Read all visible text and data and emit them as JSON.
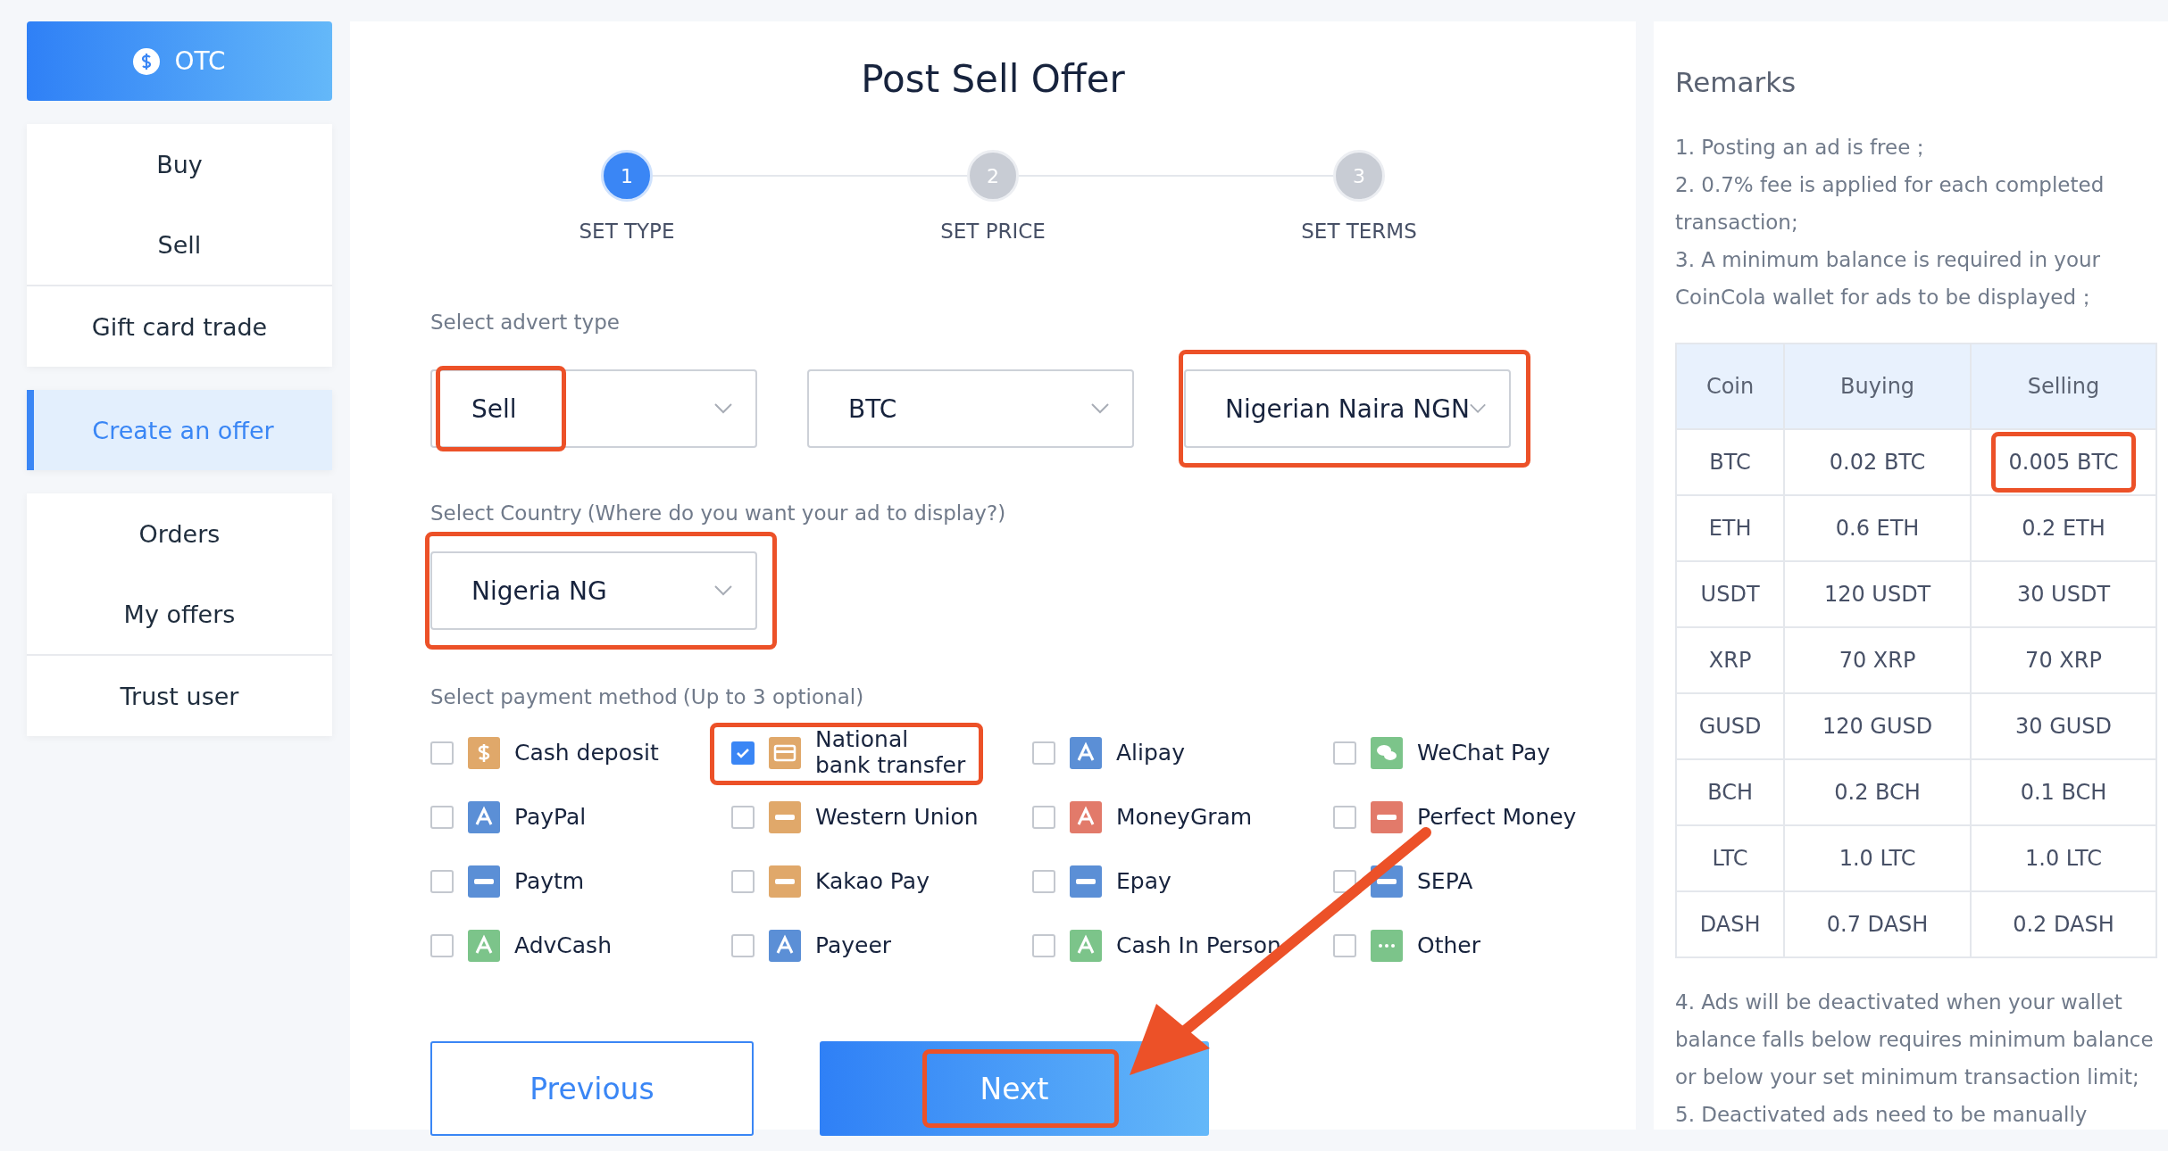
{
  "sidebar": {
    "header": {
      "label": "OTC"
    },
    "groups": [
      [
        {
          "label": "Buy",
          "selected": false
        },
        {
          "label": "Sell",
          "selected": false
        },
        {
          "label": "Gift card trade",
          "selected": false,
          "divided": true
        }
      ],
      [
        {
          "label": "Create an offer",
          "selected": true
        }
      ],
      [
        {
          "label": "Orders",
          "selected": false
        },
        {
          "label": "My offers",
          "selected": false
        },
        {
          "label": "Trust user",
          "selected": false,
          "divided": true
        }
      ]
    ]
  },
  "form": {
    "title": "Post Sell Offer",
    "steps": [
      {
        "number": "1",
        "label": "SET TYPE",
        "selected": true
      },
      {
        "number": "2",
        "label": "SET PRICE",
        "selected": false
      },
      {
        "number": "3",
        "label": "SET TERMS",
        "selected": false
      }
    ],
    "advert_type": {
      "label": "Select advert type",
      "selects": [
        {
          "value": "Sell",
          "highlighted": true
        },
        {
          "value": "BTC",
          "highlighted": false
        },
        {
          "value": "Nigerian Naira NGN",
          "highlighted": true
        }
      ]
    },
    "country": {
      "label": "Select Country",
      "hint": "(Where do you want your ad to display?)",
      "select": {
        "value": "Nigeria NG",
        "highlighted": true
      }
    },
    "payment": {
      "label": "Select payment method",
      "hint": "(Up to 3 optional)",
      "methods": [
        {
          "label": "Cash deposit",
          "checked": false,
          "highlighted": false,
          "kind": "dollar",
          "color": "#e0a86a"
        },
        {
          "label": "National bank transfer",
          "checked": true,
          "highlighted": true,
          "kind": "card",
          "color": "#e0a86a"
        },
        {
          "label": "Alipay",
          "checked": false,
          "highlighted": false,
          "kind": "glyph",
          "color": "#5b8fd6"
        },
        {
          "label": "WeChat Pay",
          "checked": false,
          "highlighted": false,
          "kind": "chat",
          "color": "#7cc48a"
        },
        {
          "label": "PayPal",
          "checked": false,
          "highlighted": false,
          "kind": "glyph",
          "color": "#5b8fd6"
        },
        {
          "label": "Western Union",
          "checked": false,
          "highlighted": false,
          "kind": "bars",
          "color": "#e0a86a"
        },
        {
          "label": "MoneyGram",
          "checked": false,
          "highlighted": false,
          "kind": "glyph",
          "color": "#e27a6a"
        },
        {
          "label": "Perfect Money",
          "checked": false,
          "highlighted": false,
          "kind": "bars",
          "color": "#e27a6a"
        },
        {
          "label": "Paytm",
          "checked": false,
          "highlighted": false,
          "kind": "bars",
          "color": "#5b8fd6"
        },
        {
          "label": "Kakao Pay",
          "checked": false,
          "highlighted": false,
          "kind": "bars",
          "color": "#e0a86a"
        },
        {
          "label": "Epay",
          "checked": false,
          "highlighted": false,
          "kind": "bars",
          "color": "#5b8fd6"
        },
        {
          "label": "SEPA",
          "checked": false,
          "highlighted": false,
          "kind": "bars",
          "color": "#5b8fd6"
        },
        {
          "label": "AdvCash",
          "checked": false,
          "highlighted": false,
          "kind": "glyph",
          "color": "#7cc48a"
        },
        {
          "label": "Payeer",
          "checked": false,
          "highlighted": false,
          "kind": "glyph",
          "color": "#5b8fd6"
        },
        {
          "label": "Cash In Person",
          "checked": false,
          "highlighted": false,
          "kind": "glyph",
          "color": "#7cc48a"
        },
        {
          "label": "Other",
          "checked": false,
          "highlighted": false,
          "kind": "dots",
          "color": "#7cc48a"
        }
      ]
    },
    "buttons": [
      {
        "label": "Previous",
        "kind": "outline",
        "highlighted": false
      },
      {
        "label": "Next",
        "kind": "primary",
        "highlighted": true
      }
    ]
  },
  "remarks": {
    "title": "Remarks",
    "notes_before": [
      "1. Posting an ad is free；",
      "2. 0.7% fee is applied for each completed transaction;",
      "3. A minimum balance is required in your CoinCola wallet for ads to be displayed；"
    ],
    "table": {
      "columns": [
        "Coin",
        "Buying",
        "Selling"
      ],
      "rows": [
        [
          {
            "text": "BTC"
          },
          {
            "text": "0.02 BTC"
          },
          {
            "text": "0.005 BTC",
            "highlighted": true
          }
        ],
        [
          {
            "text": "ETH"
          },
          {
            "text": "0.6 ETH"
          },
          {
            "text": "0.2 ETH"
          }
        ],
        [
          {
            "text": "USDT"
          },
          {
            "text": "120 USDT"
          },
          {
            "text": "30 USDT"
          }
        ],
        [
          {
            "text": "XRP"
          },
          {
            "text": "70 XRP"
          },
          {
            "text": "70 XRP"
          }
        ],
        [
          {
            "text": "GUSD"
          },
          {
            "text": "120 GUSD"
          },
          {
            "text": "30 GUSD"
          }
        ],
        [
          {
            "text": "BCH"
          },
          {
            "text": "0.2 BCH"
          },
          {
            "text": "0.1 BCH"
          }
        ],
        [
          {
            "text": "LTC"
          },
          {
            "text": "1.0 LTC"
          },
          {
            "text": "1.0 LTC"
          }
        ],
        [
          {
            "text": "DASH"
          },
          {
            "text": "0.7 DASH"
          },
          {
            "text": "0.2 DASH"
          }
        ]
      ]
    },
    "notes_after": [
      "4. Ads will be deactivated when your wallet balance falls below requires minimum balance or below your set minimum transaction limit;",
      "5. Deactivated ads need to be manually"
    ]
  },
  "annotation_arrow": {
    "shown": true
  }
}
